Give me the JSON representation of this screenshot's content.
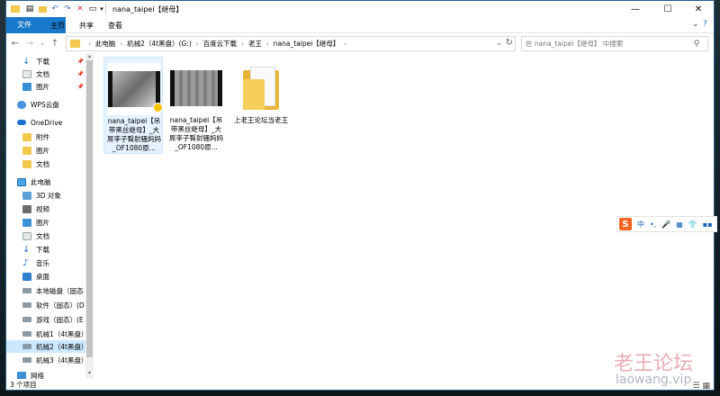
{
  "window": {
    "title": "nana_taipei【继母】",
    "controls": {
      "minimize": "—",
      "maximize": "☐",
      "close": "✕"
    }
  },
  "ribbon": {
    "tabs": [
      "文件",
      "主页",
      "共享",
      "查看"
    ]
  },
  "address": {
    "crumbs": [
      "此电脑",
      "机械2（4t黑盘）(G:)",
      "百度云下载",
      "老王",
      "nana_taipei【继母】"
    ],
    "search_placeholder": "在 nana_taipei【继母】 中搜索"
  },
  "sidebar": {
    "items": [
      {
        "label": "下载",
        "icon": "download-arrow-icon",
        "pinned": true
      },
      {
        "label": "文档",
        "icon": "document-icon",
        "pinned": true
      },
      {
        "label": "图片",
        "icon": "picture-icon",
        "pinned": true
      },
      {
        "label": "WPS云盘",
        "icon": "wps-cloud-icon",
        "pinned": false
      },
      {
        "label": "OneDrive",
        "icon": "onedrive-cloud-icon",
        "pinned": false
      },
      {
        "label": "附件",
        "icon": "folder-icon",
        "pinned": false
      },
      {
        "label": "图片",
        "icon": "folder-icon",
        "pinned": false
      },
      {
        "label": "文档",
        "icon": "folder-icon",
        "pinned": false
      },
      {
        "label": "此电脑",
        "icon": "computer-icon",
        "pinned": false
      },
      {
        "label": "3D 对象",
        "icon": "3d-objects-icon",
        "pinned": false
      },
      {
        "label": "视频",
        "icon": "video-icon",
        "pinned": false
      },
      {
        "label": "图片",
        "icon": "picture-icon",
        "pinned": false
      },
      {
        "label": "文档",
        "icon": "document-icon",
        "pinned": false
      },
      {
        "label": "下载",
        "icon": "download-arrow-icon",
        "pinned": false
      },
      {
        "label": "音乐",
        "icon": "music-icon",
        "pinned": false
      },
      {
        "label": "桌面",
        "icon": "desktop-icon",
        "pinned": false
      },
      {
        "label": "本地磁盘（固态",
        "icon": "drive-icon",
        "pinned": false
      },
      {
        "label": "软件（固态）(D",
        "icon": "drive-icon",
        "pinned": false
      },
      {
        "label": "游戏（固态）(E",
        "icon": "drive-icon",
        "pinned": false
      },
      {
        "label": "机械1（4t黑盘）",
        "icon": "drive-icon",
        "pinned": false
      },
      {
        "label": "机械2（4t黑盘）",
        "icon": "drive-icon",
        "pinned": false,
        "selected": true
      },
      {
        "label": "机械3（4t黑盘）",
        "icon": "drive-icon",
        "pinned": false
      },
      {
        "label": "网络",
        "icon": "network-icon",
        "pinned": false
      }
    ]
  },
  "files": [
    {
      "name": "nana_taipei【吊带黑丝继母】_大屌李子臀射骚妈妈_OF1080原...",
      "type": "video",
      "selected": true
    },
    {
      "name": "nana_taipei【吊带黑丝继母】_大屌李子臀射骚妈妈_OF1080原...",
      "type": "video",
      "selected": false
    },
    {
      "name": "上老王论坛当老王",
      "type": "folder",
      "selected": false
    }
  ],
  "status": {
    "count": "3 个项目"
  },
  "ime": {
    "logo": "S",
    "items": [
      "中",
      "•,",
      "🎤",
      "▦",
      "👕",
      "▪▪"
    ]
  },
  "watermark": {
    "line1": "老王论坛",
    "line2": "laowang.vip"
  },
  "colors": {
    "accent": "#1979ca",
    "selection": "#cce8ff",
    "folder": "#f6cf5b",
    "ime": "#f26522"
  }
}
